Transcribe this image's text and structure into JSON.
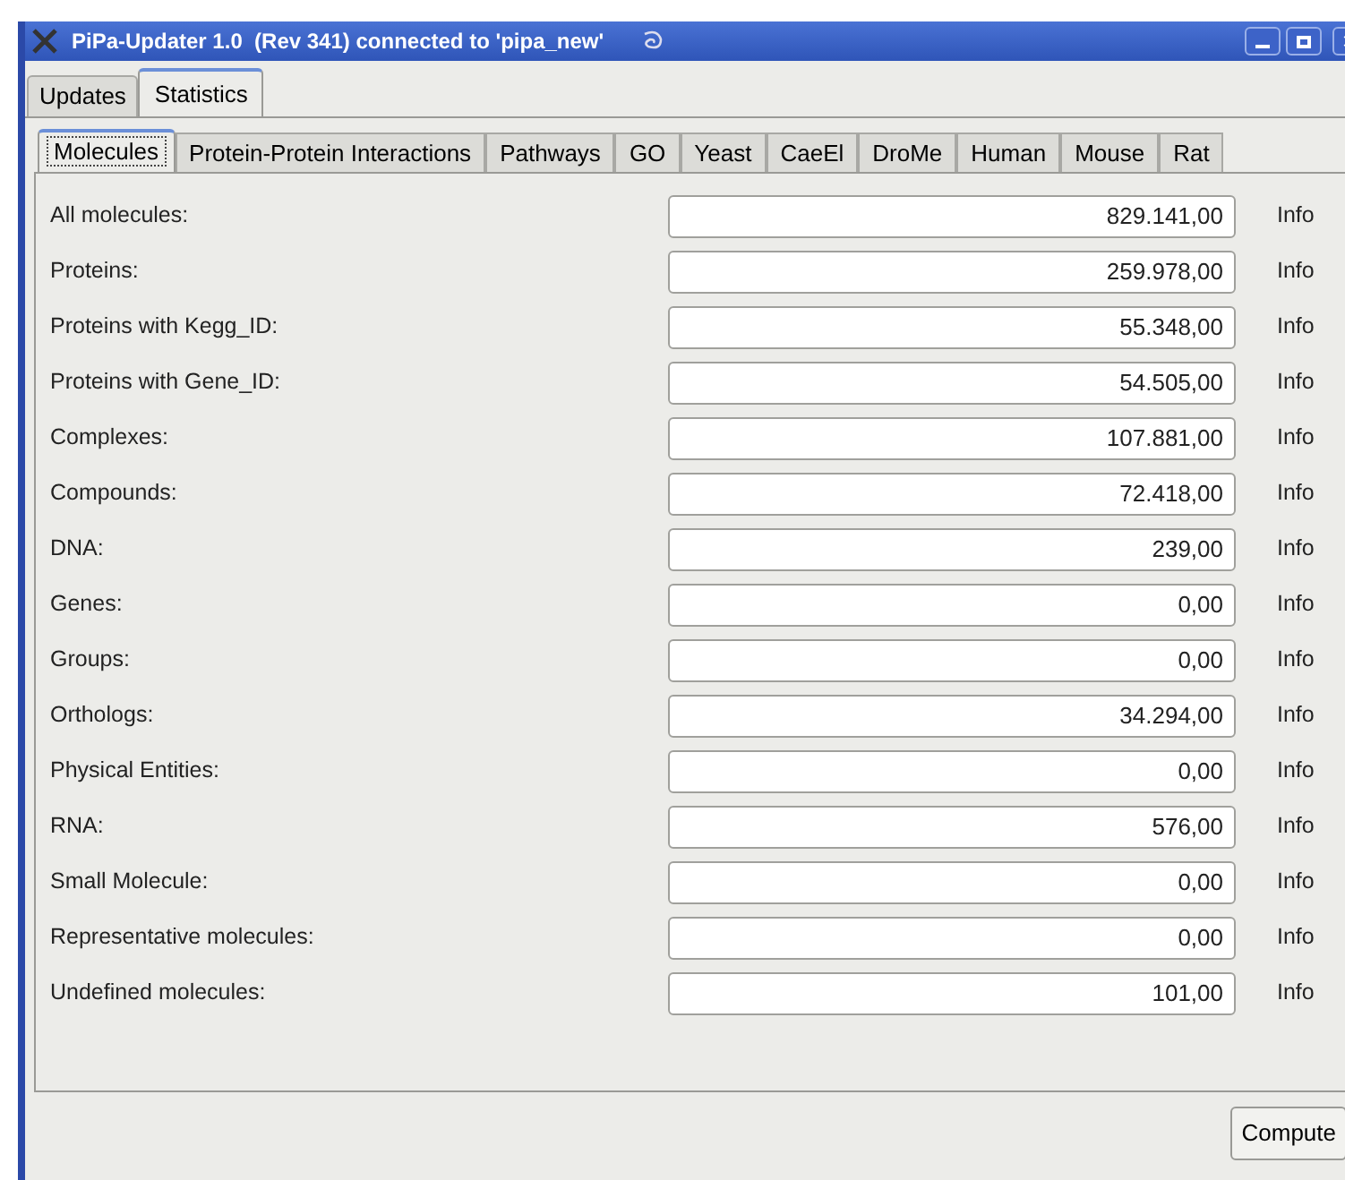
{
  "window": {
    "title": "PiPa-Updater 1.0  (Rev 341) connected to 'pipa_new'"
  },
  "tabs": [
    {
      "label": "Updates",
      "selected": false
    },
    {
      "label": "Statistics",
      "selected": true
    }
  ],
  "subtabs": [
    {
      "label": "Molecules",
      "selected": true
    },
    {
      "label": "Protein-Protein Interactions",
      "selected": false
    },
    {
      "label": "Pathways",
      "selected": false
    },
    {
      "label": "GO",
      "selected": false
    },
    {
      "label": "Yeast",
      "selected": false
    },
    {
      "label": "CaeEl",
      "selected": false
    },
    {
      "label": "DroMe",
      "selected": false
    },
    {
      "label": "Human",
      "selected": false
    },
    {
      "label": "Mouse",
      "selected": false
    },
    {
      "label": "Rat",
      "selected": false
    }
  ],
  "rows": [
    {
      "label": "All molecules:",
      "value": "829.141,00",
      "info": "Info"
    },
    {
      "label": "Proteins:",
      "value": "259.978,00",
      "info": "Info"
    },
    {
      "label": "Proteins with Kegg_ID:",
      "value": "55.348,00",
      "info": "Info"
    },
    {
      "label": "Proteins with Gene_ID:",
      "value": "54.505,00",
      "info": "Info"
    },
    {
      "label": "Complexes:",
      "value": "107.881,00",
      "info": "Info"
    },
    {
      "label": "Compounds:",
      "value": "72.418,00",
      "info": "Info"
    },
    {
      "label": "DNA:",
      "value": "239,00",
      "info": "Info"
    },
    {
      "label": "Genes:",
      "value": "0,00",
      "info": "Info"
    },
    {
      "label": "Groups:",
      "value": "0,00",
      "info": "Info"
    },
    {
      "label": "Orthologs:",
      "value": "34.294,00",
      "info": "Info"
    },
    {
      "label": "Physical Entities:",
      "value": "0,00",
      "info": "Info"
    },
    {
      "label": "RNA:",
      "value": "576,00",
      "info": "Info"
    },
    {
      "label": "Small Molecule:",
      "value": "0,00",
      "info": "Info"
    },
    {
      "label": "Representative molecules:",
      "value": "0,00",
      "info": "Info"
    },
    {
      "label": "Undefined molecules:",
      "value": "101,00",
      "info": "Info"
    }
  ],
  "compute_button": "Compute"
}
